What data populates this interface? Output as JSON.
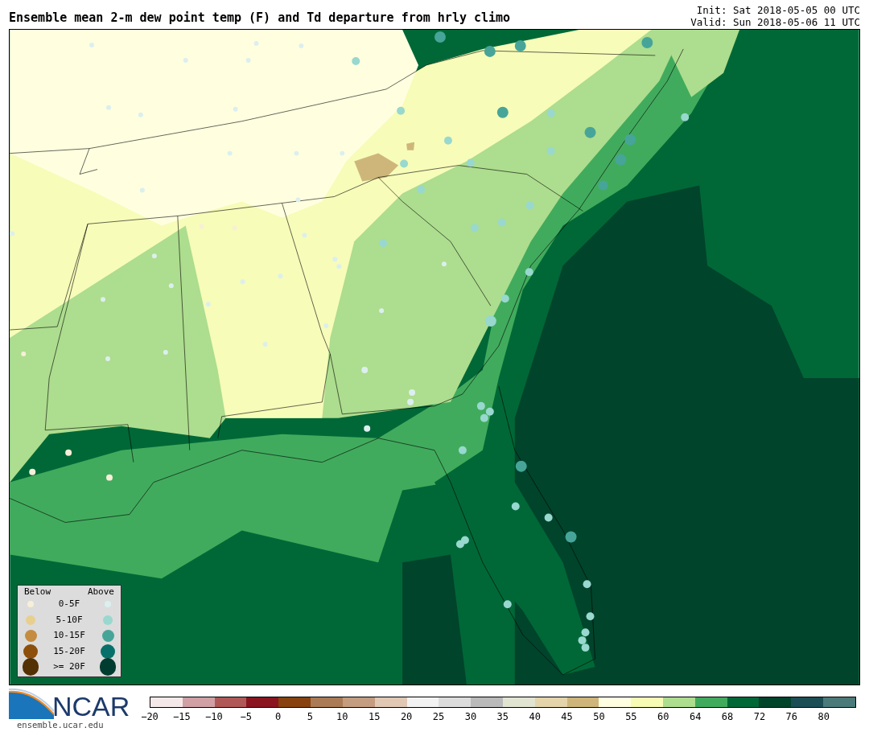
{
  "title": "Ensemble mean 2-m dew point temp (F) and Td departure from hrly climo",
  "init": "Init: Sat 2018-05-05 00 UTC",
  "valid": "Valid: Sun 2018-05-06 11 UTC",
  "legend": {
    "below_header": "Below",
    "above_header": "Above",
    "rows": [
      {
        "label": "0-5F",
        "below": {
          "color": "#f7efd8"
        },
        "above": {
          "color": "#dcefef"
        }
      },
      {
        "label": "5-10F",
        "below": {
          "color": "#e8cf90"
        },
        "above": {
          "color": "#98d8cf"
        }
      },
      {
        "label": "10-15F",
        "below": {
          "color": "#c48c40"
        },
        "above": {
          "color": "#46a598"
        }
      },
      {
        "label": "15-20F",
        "below": {
          "color": "#8c500c"
        },
        "above": {
          "color": "#08706a"
        }
      },
      {
        "label": ">= 20F",
        "below": {
          "color": "#543005"
        },
        "above": {
          "color": "#003c30"
        }
      }
    ]
  },
  "colorbar": {
    "bins": [
      {
        "color": "#f5e8e8"
      },
      {
        "color": "#d0a0a4"
      },
      {
        "color": "#b05858"
      },
      {
        "color": "#8a1520"
      },
      {
        "color": "#87420f"
      },
      {
        "color": "#ab7b55"
      },
      {
        "color": "#c49c80"
      },
      {
        "color": "#e0c8b4"
      },
      {
        "color": "#f2f2f2"
      },
      {
        "color": "#dcdcdc"
      },
      {
        "color": "#bababa"
      },
      {
        "color": "#e2e4d2"
      },
      {
        "color": "#e4d4aa"
      },
      {
        "color": "#ceb67a"
      },
      {
        "color": "#fffee0"
      },
      {
        "color": "#f7fcb4"
      },
      {
        "color": "#addd8e"
      },
      {
        "color": "#41ab5d"
      },
      {
        "color": "#006837"
      },
      {
        "color": "#00442b"
      },
      {
        "color": "#1c4e56"
      },
      {
        "color": "#4a7a7a"
      }
    ],
    "ticks": [
      "−20",
      "−15",
      "−10",
      "−5",
      "0",
      "5",
      "10",
      "15",
      "20",
      "25",
      "30",
      "35",
      "40",
      "45",
      "50",
      "55",
      "60",
      "64",
      "68",
      "72",
      "76",
      "80"
    ]
  },
  "logo": {
    "text": "NCAR",
    "url": "ensemble.ucar.edu"
  }
}
